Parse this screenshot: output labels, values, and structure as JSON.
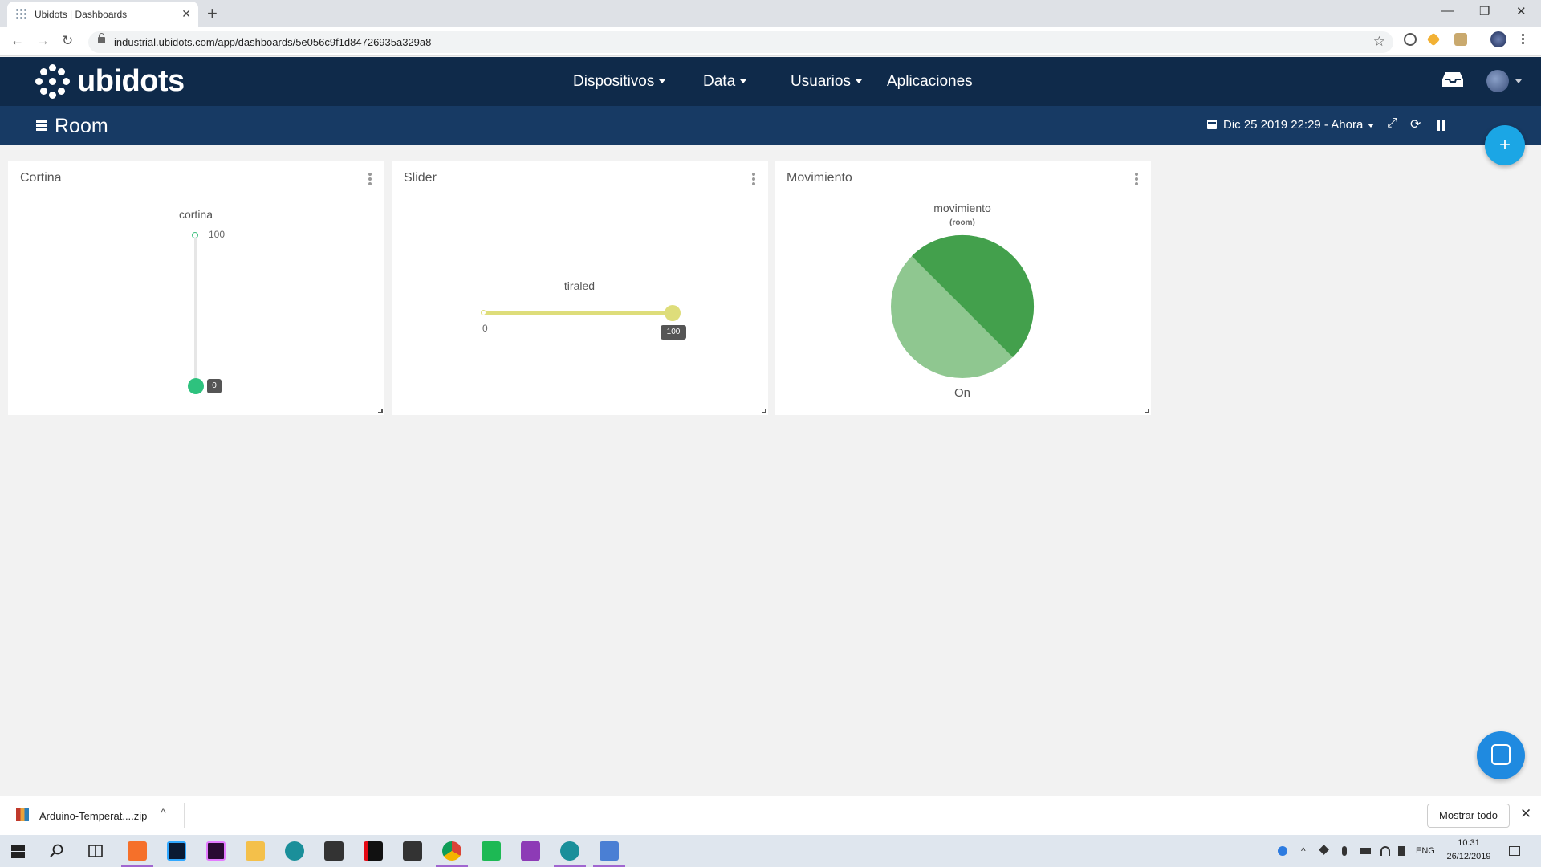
{
  "browser": {
    "tab_title": "Ubidots | Dashboards",
    "new_tab": "+",
    "tab_close": "✕",
    "url": "industrial.ubidots.com/app/dashboards/5e056c9f1d84726935a329a8",
    "back": "←",
    "forward": "→",
    "reload": "↻",
    "star": "☆",
    "window_minimize": "—",
    "window_restore": "❐",
    "window_close": "✕"
  },
  "app": {
    "logo_text": "ubidots",
    "nav": [
      {
        "label": "Dispositivos",
        "has_caret": true
      },
      {
        "label": "Data",
        "has_caret": true
      },
      {
        "label": "Usuarios",
        "has_caret": true
      },
      {
        "label": "Aplicaciones",
        "has_caret": false
      }
    ]
  },
  "dashboard": {
    "title": "Room",
    "date_range": "Dic 25 2019 22:29 - Ahora",
    "expand_icon": "⤢",
    "refresh_icon": "⟳",
    "add_button": "+"
  },
  "widgets": {
    "cortina": {
      "title": "Cortina",
      "variable": "cortina",
      "max_label": "100",
      "value": "0",
      "level_fraction": 0,
      "colors": {
        "track": "#e6e6e6",
        "knob": "#2ec27e"
      }
    },
    "slider": {
      "title": "Slider",
      "variable": "tiraled",
      "min_label": "0",
      "value": "100",
      "level_fraction": 1,
      "colors": {
        "track": "#dedd7a"
      }
    },
    "movimiento": {
      "title": "Movimiento",
      "variable": "movimiento",
      "device": "(room)",
      "caption": "On",
      "colors": {
        "dark_slice": "#43a04c",
        "light_slice": "#8fc790"
      }
    }
  },
  "download_shelf": {
    "file_name": "Arduino-Temperat....zip",
    "show_all": "Mostrar todo",
    "close": "✕",
    "expand": "^"
  },
  "taskbar": {
    "language": "ENG",
    "time": "10:31",
    "date": "26/12/2019"
  }
}
